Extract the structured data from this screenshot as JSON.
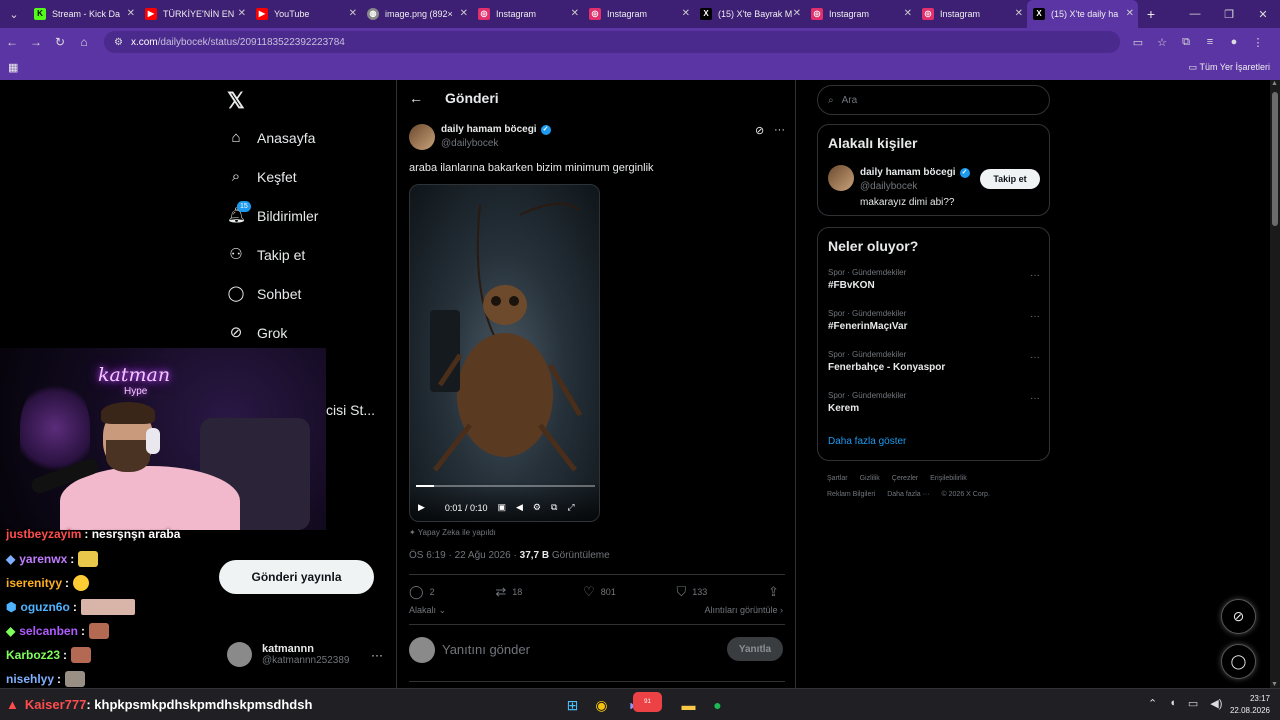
{
  "browser": {
    "tabs": [
      {
        "label": "Stream - Kick Da",
        "icon": "kick-icon",
        "color": "#53fc18"
      },
      {
        "label": "TÜRKİYE'NİN EN",
        "icon": "youtube-icon",
        "color": "#ff0000"
      },
      {
        "label": "YouTube",
        "icon": "youtube-icon",
        "color": "#ff0000"
      },
      {
        "label": "image.png (892×",
        "icon": "globe-icon",
        "color": "#888888"
      },
      {
        "label": "Instagram",
        "icon": "instagram-icon",
        "color": "#e1306c"
      },
      {
        "label": "Instagram",
        "icon": "instagram-icon",
        "color": "#e1306c"
      },
      {
        "label": "(15) X'te Bayrak M",
        "icon": "x-icon",
        "color": "#000000"
      },
      {
        "label": "Instagram",
        "icon": "instagram-icon",
        "color": "#e1306c"
      },
      {
        "label": "Instagram",
        "icon": "instagram-icon",
        "color": "#e1306c"
      },
      {
        "label": "(15) X'te daily ha",
        "icon": "x-icon",
        "color": "#000000"
      }
    ],
    "url_domain": "x.com",
    "url_path": "/dailybocek/status/2091183522392223784",
    "bookmarks_all": "Tüm Yer İşaretleri"
  },
  "sidebar": {
    "items": [
      {
        "label": "Anasayfa",
        "icon": "home-icon"
      },
      {
        "label": "Keşfet",
        "icon": "search-icon"
      },
      {
        "label": "Bildirimler",
        "icon": "bell-icon",
        "badge": "15"
      },
      {
        "label": "Takip et",
        "icon": "person-add-icon"
      },
      {
        "label": "Sohbet",
        "icon": "chat-icon"
      },
      {
        "label": "Grok",
        "icon": "grok-icon"
      }
    ],
    "partial_text": "cisi St...",
    "post_button": "Gönderi yayınla",
    "account": {
      "name": "katmannn",
      "handle": "@katmannn252389"
    }
  },
  "main": {
    "title": "Gönderi",
    "tweet": {
      "author": "daily hamam böcegi",
      "handle": "@dailybocek",
      "text": "araba ilanlarına bakarken bizim minimum gerginlik",
      "video_time": "0:01 / 0:10",
      "video_progress": 0.1,
      "ai_note": "Yapay Zeka ile yapıldı",
      "timestamp": "ÖS 6:19 · 22 Ağu 2026 ·",
      "views": "37,7 B",
      "views_label": "Görüntüleme",
      "replies": "2",
      "reposts": "18",
      "likes": "801",
      "bookmarks": "133",
      "related": "Alakalı",
      "quotes": "Alıntıları görüntüle"
    },
    "reply": {
      "placeholder": "Yanıtını gönder",
      "button": "Yanıtla"
    }
  },
  "right": {
    "search_placeholder": "Ara",
    "relevant": {
      "title": "Alakalı kişiler",
      "name": "daily hamam böcegi",
      "handle": "@dailybocek",
      "bio": "makarayız dimi abi??",
      "follow": "Takip et"
    },
    "trends": {
      "title": "Neler oluyor?",
      "items": [
        {
          "category": "Spor · Gündemdekiler",
          "name": "#FBvKON"
        },
        {
          "category": "Spor · Gündemdekiler",
          "name": "#FenerinMaçıVar"
        },
        {
          "category": "Spor · Gündemdekiler",
          "name": "Fenerbahçe - Konyaspor"
        },
        {
          "category": "Spor · Gündemdekiler",
          "name": "Kerem"
        }
      ],
      "more": "Daha fazla göster"
    },
    "footer": [
      "Şartlar",
      "Gizlilik",
      "Çerezler",
      "Erişilebilirlik",
      "Reklam Bilgileri",
      "Daha fazla ···",
      "© 2026 X Corp."
    ]
  },
  "stream_overlay": {
    "neon": "katman",
    "neon_sub": "Hype",
    "chat": [
      {
        "user": "justbeyzayim",
        "color": "#ff4d4d",
        "msg": ": nesrşnşn araba"
      },
      {
        "user": "yarenwx",
        "color": "#c07bff",
        "msg": ":"
      },
      {
        "user": "iserenityy",
        "color": "#ffb020",
        "msg": ":"
      },
      {
        "user": "oguzn6o",
        "color": "#4fb3ff",
        "msg": ":"
      },
      {
        "user": "selcanben",
        "color": "#b05bff",
        "msg": ":"
      },
      {
        "user": "Karboz23",
        "color": "#7fff5a",
        "msg": ":"
      },
      {
        "user": "nisehlyy",
        "color": "#7fb0ff",
        "msg": ":"
      }
    ],
    "bottom_chat": {
      "user": "Kaiser777",
      "color": "#ff4d4d",
      "msg": ": khpkpsmkpdhskpmdhskpmsdhdsh"
    }
  },
  "taskbar": {
    "time": "23:17",
    "date": "22.08.2026",
    "discord_badge": "91"
  }
}
